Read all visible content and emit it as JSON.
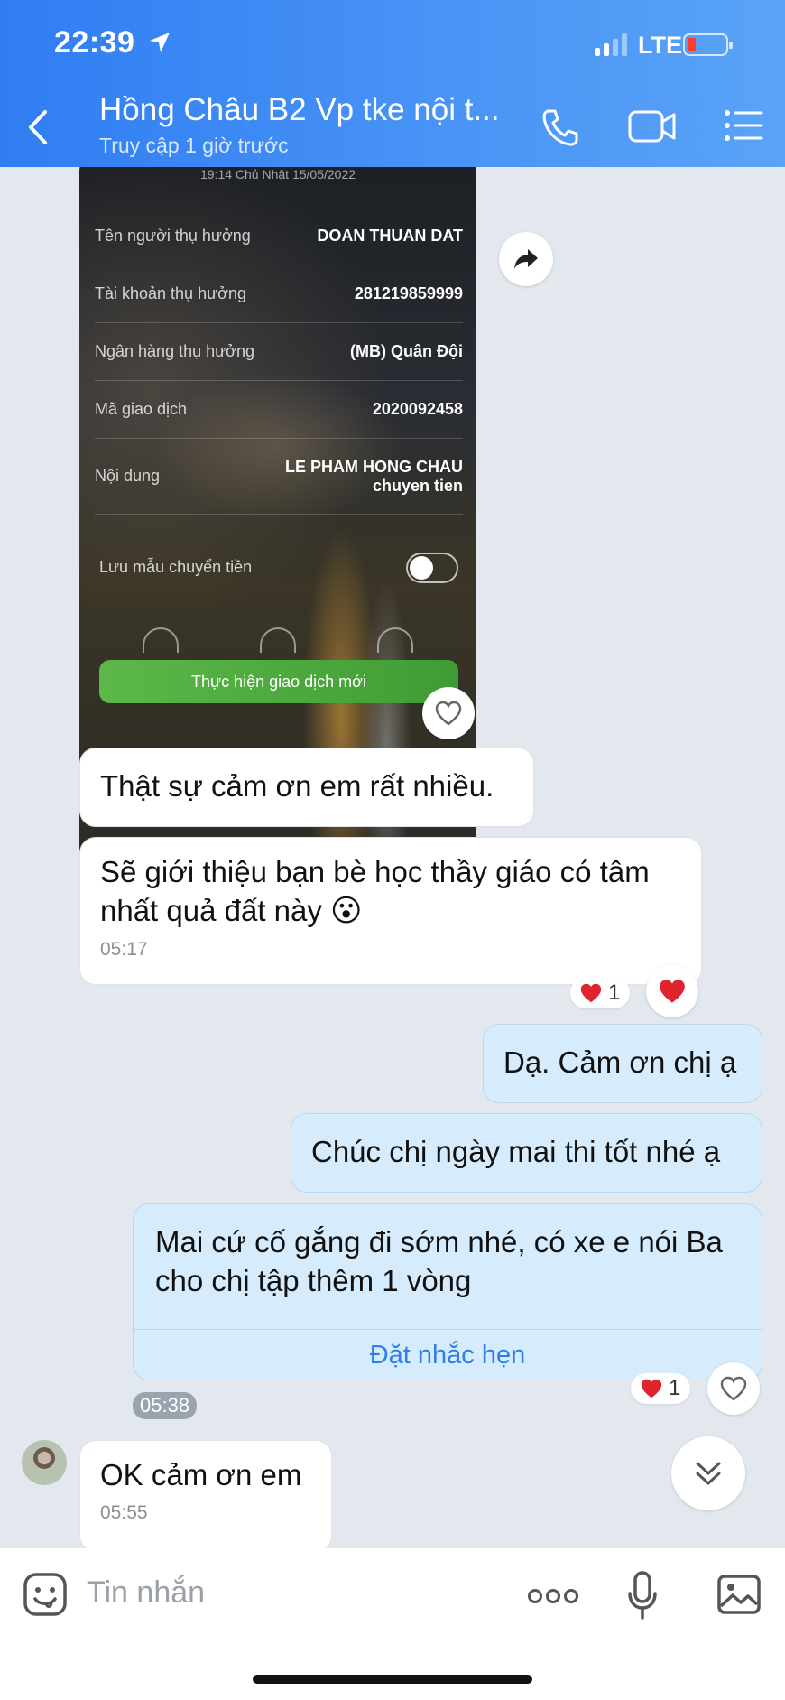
{
  "status_bar": {
    "time": "22:39",
    "network": "LTE"
  },
  "header": {
    "title": "Hồng Châu B2 Vp tke nội t...",
    "subtitle": "Truy cập 1 giờ trước"
  },
  "receipt": {
    "datetime": "19:14 Chủ Nhật 15/05/2022",
    "rows": [
      {
        "label": "Tên người thụ hưởng",
        "value": "DOAN THUAN DAT"
      },
      {
        "label": "Tài khoản thụ hưởng",
        "value": "281219859999"
      },
      {
        "label": "Ngân hàng thụ hưởng",
        "value": "(MB) Quân Đội"
      },
      {
        "label": "Mã giao dịch",
        "value": "2020092458"
      },
      {
        "label": "Nội dung",
        "value_line1": "LE PHAM HONG CHAU",
        "value_line2": "chuyen tien"
      }
    ],
    "save_template_label": "Lưu mẫu chuyển tiền",
    "new_transaction_button": "Thực hiện giao dịch mới"
  },
  "messages": [
    {
      "direction": "in",
      "text": "Thật sự cảm ơn em rất nhiều."
    },
    {
      "direction": "in",
      "text_line1": "Sẽ giới thiệu bạn bè học thầy giáo có tâm",
      "text_line2": "nhất quả đất này",
      "emoji": "😮",
      "time": "05:17",
      "reaction_count": "1"
    },
    {
      "direction": "out",
      "text": "Dạ. Cảm ơn chị ạ"
    },
    {
      "direction": "out",
      "text": "Chúc chị ngày mai thi tốt nhé ạ"
    },
    {
      "direction": "out",
      "text_line1": "Mai cứ cố gắng đi sớm nhé, có xe e nói Ba",
      "text_line2": "cho chị tập thêm 1 vòng",
      "action": "Đặt nhắc hẹn",
      "time": "05:38",
      "reaction_count": "1"
    },
    {
      "direction": "in",
      "text": "OK cảm ơn em",
      "time": "05:55"
    }
  ],
  "input": {
    "placeholder": "Tin nhắn"
  },
  "colors": {
    "header": "#2f7df2",
    "outgoing_bubble": "#d6ecfd",
    "link": "#2c7ee8",
    "heart": "#e0242f"
  }
}
